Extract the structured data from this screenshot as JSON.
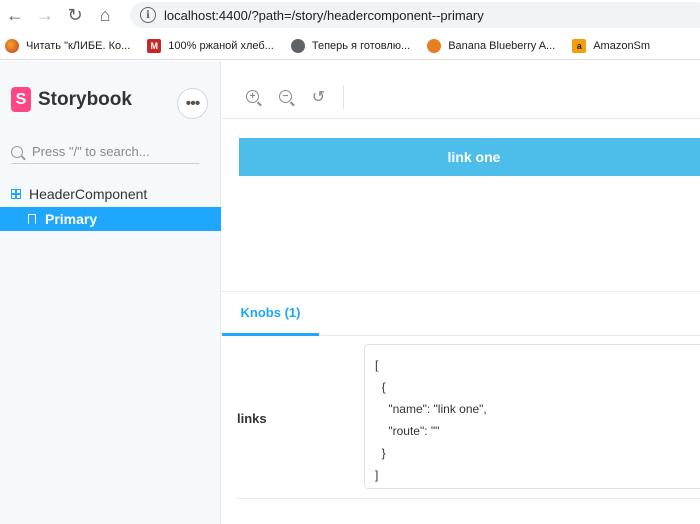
{
  "browser": {
    "url": "localhost:4400/?path=/story/headercomponent--primary",
    "bookmarks": [
      {
        "label": "Читать \"кЛИБЕ. Ко...",
        "icon": "orange-circle-icon"
      },
      {
        "label": "100% ржаной хлеб...",
        "icon": "m-letter-icon"
      },
      {
        "label": "Теперь я готовлю...",
        "icon": "globe-icon"
      },
      {
        "label": "Banana Blueberry A...",
        "icon": "ar-badge-icon"
      },
      {
        "label": "AmazonSm",
        "icon": "amazon-icon"
      }
    ]
  },
  "sidebar": {
    "brand": "Storybook",
    "brand_mark": "S",
    "search_placeholder": "Press \"/\" to search...",
    "component": "HeaderComponent",
    "story": "Primary"
  },
  "preview": {
    "link_label": "link one"
  },
  "addons": {
    "tab_label": "Knobs (1)",
    "knob_name": "links",
    "knob_value": "[\n  {\n    \"name\": \"link one\",\n    \"route\": \"\"\n  }\n]"
  }
}
